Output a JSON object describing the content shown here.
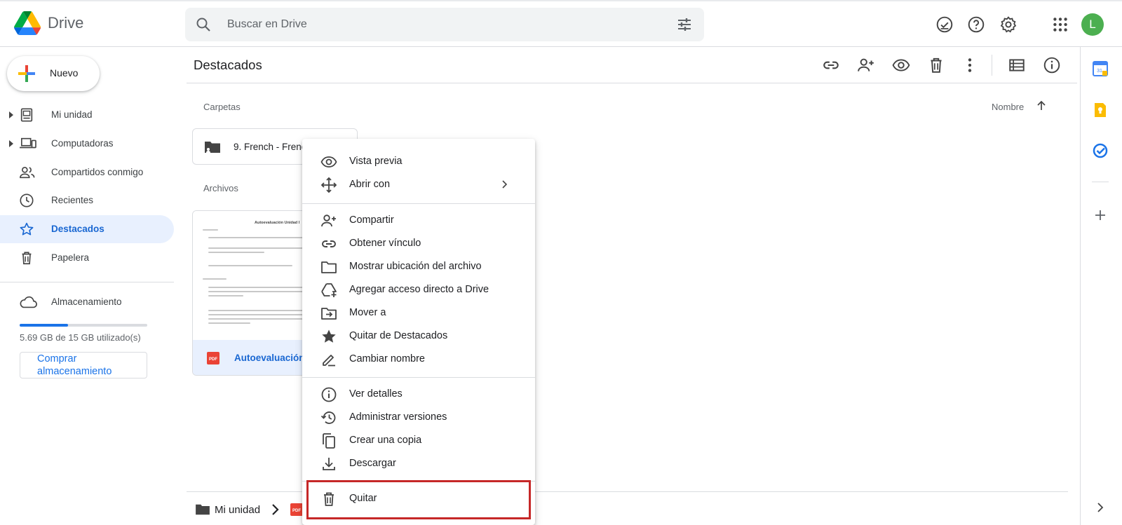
{
  "header": {
    "app_name": "Drive",
    "search_placeholder": "Buscar en Drive",
    "avatar_initial": "L",
    "icons": [
      "search-icon",
      "tune-icon",
      "offline-status-icon",
      "help-icon",
      "settings-icon",
      "apps-grid-icon"
    ]
  },
  "sidebar": {
    "new_label": "Nuevo",
    "items": [
      {
        "label": "Mi unidad",
        "icon": "my-drive-icon"
      },
      {
        "label": "Computadoras",
        "icon": "computers-icon"
      },
      {
        "label": "Compartidos conmigo",
        "icon": "shared-icon"
      },
      {
        "label": "Recientes",
        "icon": "clock-icon"
      },
      {
        "label": "Destacados",
        "icon": "star-icon"
      },
      {
        "label": "Papelera",
        "icon": "trash-icon"
      }
    ],
    "storage_label": "Almacenamiento",
    "storage_usage": "5.69 GB de 15 GB utilizado(s)",
    "storage_fraction": 0.379,
    "buy_label": "Comprar almacenamiento"
  },
  "main": {
    "title": "Destacados",
    "folders_label": "Carpetas",
    "files_label": "Archivos",
    "sort_label": "Nombre",
    "folder_name": "9. French - French",
    "file_name": "Autoevaluación Unidad I",
    "thumb_title": "Autoevaluación Unidad I",
    "breadcrumb_root": "Mi unidad"
  },
  "context_menu": {
    "items": [
      {
        "label": "Vista previa",
        "icon": "eye-icon"
      },
      {
        "label": "Abrir con",
        "icon": "open-with-icon"
      },
      {
        "label": "Compartir",
        "icon": "person-add-icon"
      },
      {
        "label": "Obtener vínculo",
        "icon": "link-icon"
      },
      {
        "label": "Mostrar ubicación del archivo",
        "icon": "folder-icon"
      },
      {
        "label": "Agregar acceso directo a Drive",
        "icon": "add-shortcut-icon"
      },
      {
        "label": "Mover a",
        "icon": "move-icon"
      },
      {
        "label": "Quitar de Destacados",
        "icon": "star-filled-icon"
      },
      {
        "label": "Cambiar nombre",
        "icon": "rename-icon"
      },
      {
        "label": "Ver detalles",
        "icon": "info-icon"
      },
      {
        "label": "Administrar versiones",
        "icon": "history-icon"
      },
      {
        "label": "Crear una copia",
        "icon": "copy-icon"
      },
      {
        "label": "Descargar",
        "icon": "download-icon"
      },
      {
        "label": "Quitar",
        "icon": "trash-icon"
      }
    ]
  },
  "colors": {
    "accent": "#1a73e8",
    "active_bg": "#e8f0fe",
    "highlight_border": "#c62828",
    "pdf_red": "#ea4335"
  }
}
